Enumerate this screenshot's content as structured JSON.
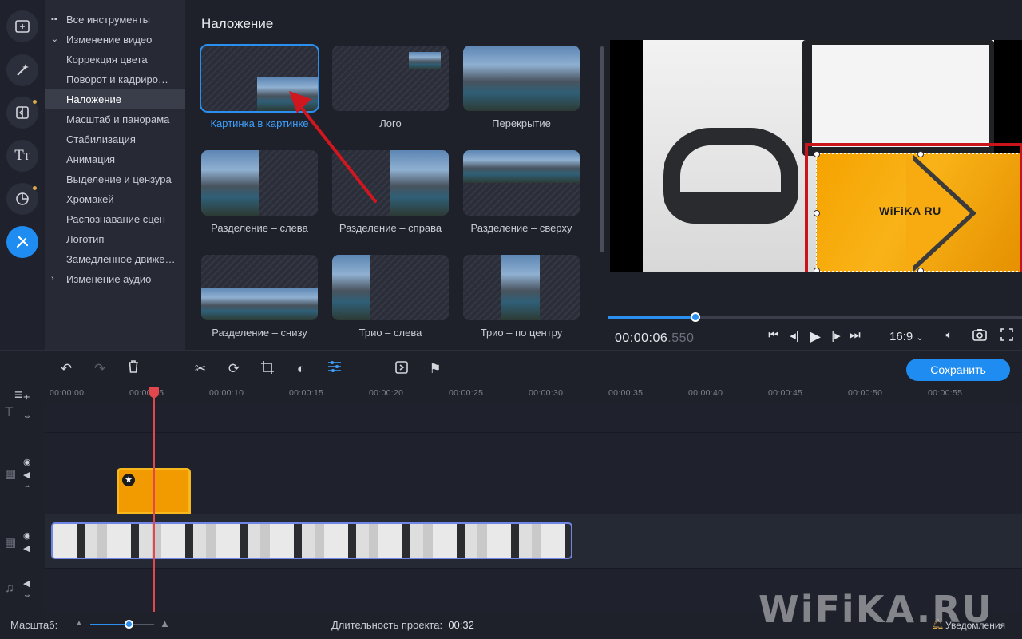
{
  "tree": {
    "items": [
      {
        "label": "Все инструменты",
        "kind": "root"
      },
      {
        "label": "Изменение видео",
        "kind": "group-open"
      },
      {
        "label": "Коррекция цвета"
      },
      {
        "label": "Поворот и кадриро…"
      },
      {
        "label": "Наложение",
        "active": true
      },
      {
        "label": "Масштаб и панорама"
      },
      {
        "label": "Стабилизация"
      },
      {
        "label": "Анимация"
      },
      {
        "label": "Выделение и цензура"
      },
      {
        "label": "Хромакей"
      },
      {
        "label": "Распознавание сцен"
      },
      {
        "label": "Логотип"
      },
      {
        "label": "Замедленное движе…"
      },
      {
        "label": "Изменение аудио",
        "kind": "group-closed"
      }
    ]
  },
  "panel": {
    "title": "Наложение",
    "cards": [
      {
        "label": "Картинка в картинке",
        "selected": true
      },
      {
        "label": "Лого"
      },
      {
        "label": "Перекрытие"
      },
      {
        "label": "Разделение – слева"
      },
      {
        "label": "Разделение – справа"
      },
      {
        "label": "Разделение – сверху"
      },
      {
        "label": "Разделение – снизу"
      },
      {
        "label": "Трио – слева"
      },
      {
        "label": "Трио – по центру"
      }
    ]
  },
  "preview": {
    "pip_text": "WiFiKA RU",
    "timecode": "00:00:06",
    "timecode_ms": ".550",
    "progress_fraction": 0.21,
    "aspect": "16:9"
  },
  "toolbar": {
    "save_label": "Сохранить"
  },
  "ruler": {
    "ticks": [
      "00:00:00",
      "00:00:05",
      "00:00:10",
      "00:00:15",
      "00:00:20",
      "00:00:25",
      "00:00:30",
      "00:00:35",
      "00:00:40",
      "00:00:45",
      "00:00:50",
      "00:00:55"
    ]
  },
  "status": {
    "zoom_label": "Масштаб:",
    "zoom_fraction": 0.6,
    "duration_label": "Длительность проекта:",
    "duration_value": "00:32",
    "notifications": "Уведомления"
  },
  "watermark": "WiFiKA.RU",
  "colors": {
    "accent": "#1f8cf2",
    "highlight_frame": "#c9141b",
    "playhead": "#e2474d",
    "clip_border": "#f6b81d"
  }
}
